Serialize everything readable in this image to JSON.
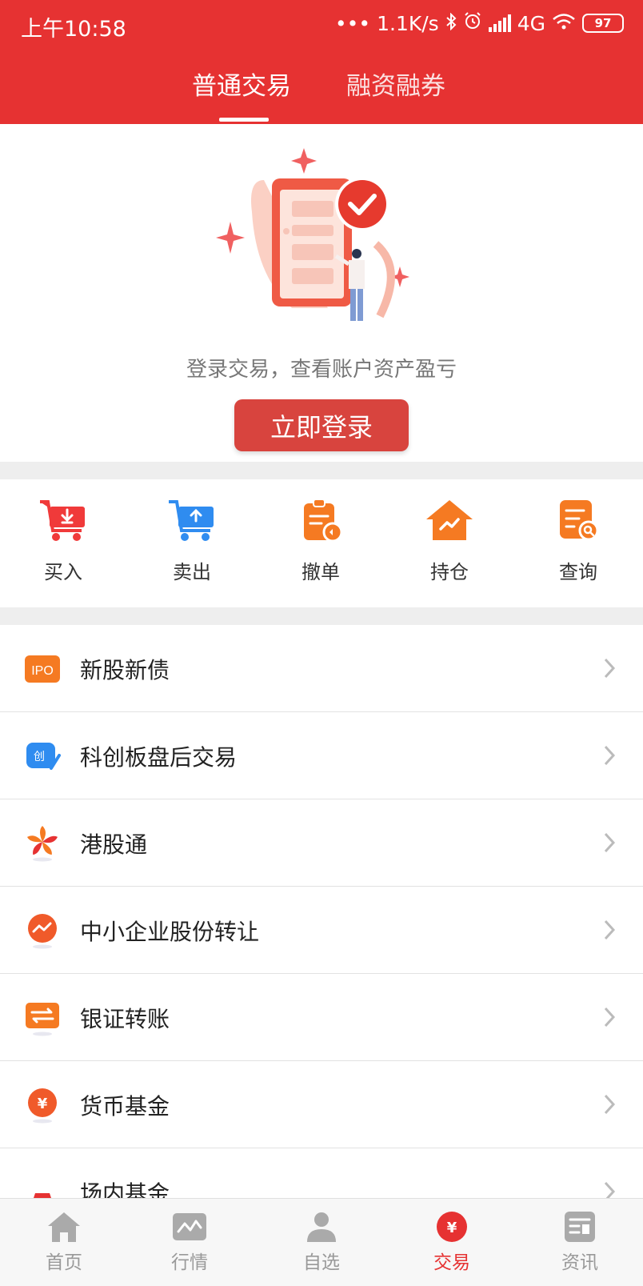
{
  "status_bar": {
    "time": "上午10:58",
    "dots": "•••",
    "net_speed": "1.1K/s",
    "network": "4G",
    "battery": "97"
  },
  "tabs": [
    {
      "label": "普通交易",
      "active": true
    },
    {
      "label": "融资融券",
      "active": false
    }
  ],
  "hero": {
    "message": "登录交易，查看账户资产盈亏",
    "login_button": "立即登录"
  },
  "actions": [
    {
      "label": "买入",
      "icon": "cart-download-icon",
      "color": "#f03a3a"
    },
    {
      "label": "卖出",
      "icon": "cart-upload-icon",
      "color": "#2f8cf0"
    },
    {
      "label": "撤单",
      "icon": "clipboard-undo-icon",
      "color": "#f57a22"
    },
    {
      "label": "持仓",
      "icon": "house-chart-icon",
      "color": "#f57a22"
    },
    {
      "label": "查询",
      "icon": "document-search-icon",
      "color": "#f57a22"
    }
  ],
  "menu": [
    {
      "label": "新股新债",
      "icon": "ipo-icon",
      "icon_text": "IPO"
    },
    {
      "label": "科创板盘后交易",
      "icon": "star-market-icon",
      "icon_text": "创"
    },
    {
      "label": "港股通",
      "icon": "bauhinia-icon"
    },
    {
      "label": "中小企业股份转让",
      "icon": "trend-circle-icon"
    },
    {
      "label": "银证转账",
      "icon": "bank-transfer-icon"
    },
    {
      "label": "货币基金",
      "icon": "money-fund-icon",
      "icon_text": "¥"
    },
    {
      "label": "场内基金",
      "icon": "gold-bars-icon"
    }
  ],
  "bottom_nav": [
    {
      "label": "首页",
      "icon": "home-icon",
      "active": false
    },
    {
      "label": "行情",
      "icon": "market-chart-icon",
      "active": false
    },
    {
      "label": "自选",
      "icon": "user-icon",
      "active": false
    },
    {
      "label": "交易",
      "icon": "yen-coin-icon",
      "active": true
    },
    {
      "label": "资讯",
      "icon": "news-icon",
      "active": false
    }
  ],
  "colors": {
    "brand_red": "#e63232",
    "button_red": "#d8443e",
    "inactive_gray": "#999999"
  }
}
